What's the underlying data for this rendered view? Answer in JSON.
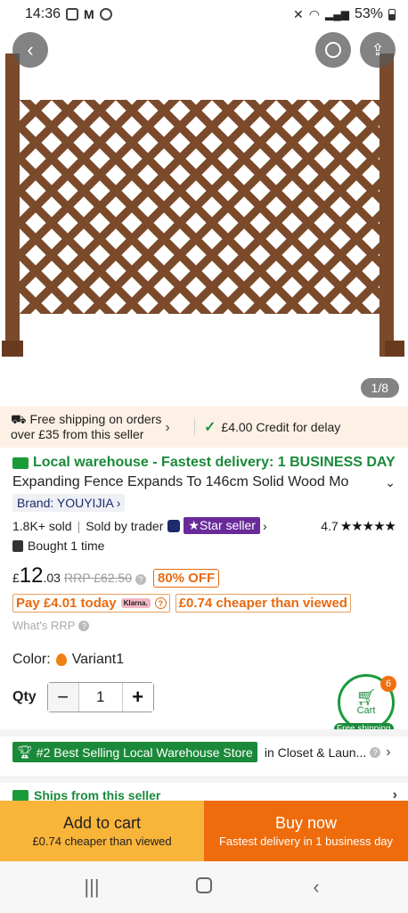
{
  "status_bar": {
    "time": "14:36",
    "battery": "53%"
  },
  "hero": {
    "pager": "1/8"
  },
  "shipping": {
    "left_line1": "Free shipping on orders",
    "left_line2": "over £35 from this seller",
    "right": "£4.00 Credit for delay"
  },
  "product": {
    "local_warehouse": "Local warehouse - Fastest delivery: 1 BUSINESS DAY",
    "title": "Expanding Fence Expands To 146cm Solid Wood Mo",
    "brand": "Brand: YOUYIJIA",
    "sold": "1.8K+ sold",
    "sold_by": "Sold by trader",
    "star_seller": "Star seller",
    "rating": "4.7",
    "stars": "★★★★★",
    "bought": "Bought 1 time"
  },
  "price": {
    "currency": "£",
    "whole": "12",
    "fraction": ".03",
    "rrp": "RRP £62.50",
    "off": "80% OFF",
    "pay_today": "Pay £4.01 today",
    "klarna": "Klarna.",
    "cheaper": "£0.74 cheaper than viewed",
    "whats_rrp": "What's RRP"
  },
  "options": {
    "color_label": "Color:",
    "color_value": "Variant1",
    "qty_label": "Qty",
    "qty_value": "1"
  },
  "cart_float": {
    "label": "Cart",
    "count": "6",
    "tag": "Free shipping"
  },
  "best_selling": {
    "chip": "#2 Best Selling Local Warehouse Store",
    "category": "in Closet & Laun..."
  },
  "ships_from": "Ships from this seller",
  "bottom": {
    "add_to_cart": "Add to cart",
    "add_sub": "£0.74 cheaper than viewed",
    "buy_now": "Buy now",
    "buy_sub": "Fastest delivery in 1 business day"
  },
  "colors": {
    "orange": "#ef6c0d",
    "yellow": "#f9b43a",
    "green": "#1a8a3a"
  }
}
